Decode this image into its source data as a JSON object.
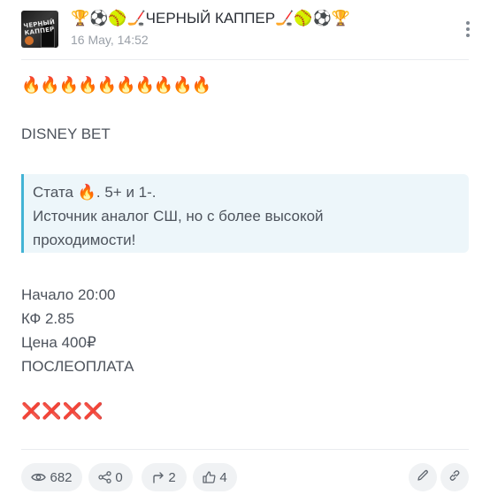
{
  "header": {
    "channel_title": "🏆⚽🥎🏒ЧЕРНЫЙ КАППЕР🏒🥎⚽🏆",
    "avatar_text": "ЧЕРНЫЙ КАППЕР",
    "time": "16 May, 14:52"
  },
  "post": {
    "fires": "🔥🔥🔥🔥🔥🔥🔥🔥🔥🔥",
    "brand": "DISNEY BET",
    "quote_line1": "Стата 🔥. 5+ и 1-.",
    "quote_line2": "Источник аналог СШ, но с более высокой",
    "quote_line3": "проходимости!",
    "start": "Начало 20:00",
    "coef": "КФ 2.85",
    "price": "Цена 400₽",
    "payment": "ПОСЛЕОПЛАТА",
    "crosses": "❌❌❌❌"
  },
  "footer": {
    "views": "682",
    "shares": "0",
    "reposts": "2",
    "likes": "4"
  },
  "icons": {
    "more": "more-vertical-icon",
    "views": "eye-icon",
    "shares": "share-icon",
    "reposts": "repost-arrow-icon",
    "likes": "thumbs-up-icon",
    "edit": "pencil-icon",
    "link": "link-icon"
  }
}
